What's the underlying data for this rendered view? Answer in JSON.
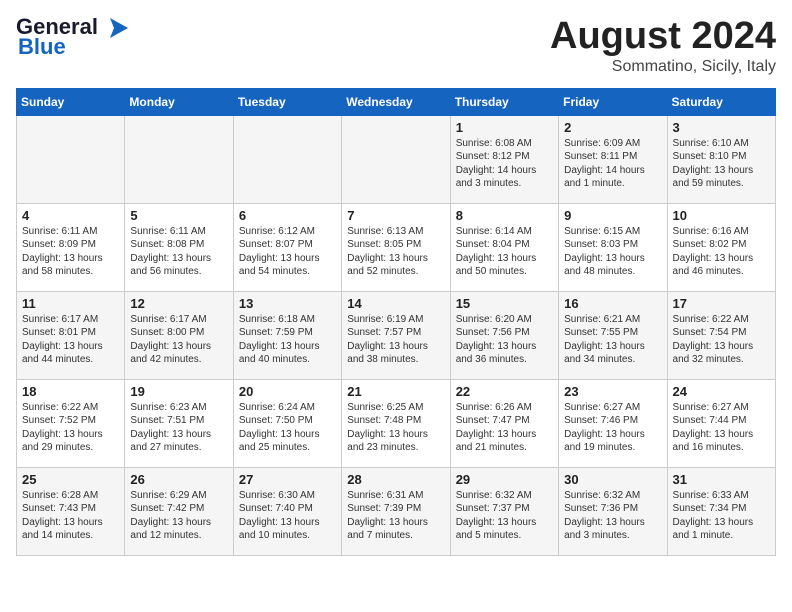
{
  "header": {
    "logo_line1": "General",
    "logo_line2": "Blue",
    "month": "August 2024",
    "location": "Sommatino, Sicily, Italy"
  },
  "weekdays": [
    "Sunday",
    "Monday",
    "Tuesday",
    "Wednesday",
    "Thursday",
    "Friday",
    "Saturday"
  ],
  "weeks": [
    [
      {
        "day": "",
        "info": ""
      },
      {
        "day": "",
        "info": ""
      },
      {
        "day": "",
        "info": ""
      },
      {
        "day": "",
        "info": ""
      },
      {
        "day": "1",
        "info": "Sunrise: 6:08 AM\nSunset: 8:12 PM\nDaylight: 14 hours\nand 3 minutes."
      },
      {
        "day": "2",
        "info": "Sunrise: 6:09 AM\nSunset: 8:11 PM\nDaylight: 14 hours\nand 1 minute."
      },
      {
        "day": "3",
        "info": "Sunrise: 6:10 AM\nSunset: 8:10 PM\nDaylight: 13 hours\nand 59 minutes."
      }
    ],
    [
      {
        "day": "4",
        "info": "Sunrise: 6:11 AM\nSunset: 8:09 PM\nDaylight: 13 hours\nand 58 minutes."
      },
      {
        "day": "5",
        "info": "Sunrise: 6:11 AM\nSunset: 8:08 PM\nDaylight: 13 hours\nand 56 minutes."
      },
      {
        "day": "6",
        "info": "Sunrise: 6:12 AM\nSunset: 8:07 PM\nDaylight: 13 hours\nand 54 minutes."
      },
      {
        "day": "7",
        "info": "Sunrise: 6:13 AM\nSunset: 8:05 PM\nDaylight: 13 hours\nand 52 minutes."
      },
      {
        "day": "8",
        "info": "Sunrise: 6:14 AM\nSunset: 8:04 PM\nDaylight: 13 hours\nand 50 minutes."
      },
      {
        "day": "9",
        "info": "Sunrise: 6:15 AM\nSunset: 8:03 PM\nDaylight: 13 hours\nand 48 minutes."
      },
      {
        "day": "10",
        "info": "Sunrise: 6:16 AM\nSunset: 8:02 PM\nDaylight: 13 hours\nand 46 minutes."
      }
    ],
    [
      {
        "day": "11",
        "info": "Sunrise: 6:17 AM\nSunset: 8:01 PM\nDaylight: 13 hours\nand 44 minutes."
      },
      {
        "day": "12",
        "info": "Sunrise: 6:17 AM\nSunset: 8:00 PM\nDaylight: 13 hours\nand 42 minutes."
      },
      {
        "day": "13",
        "info": "Sunrise: 6:18 AM\nSunset: 7:59 PM\nDaylight: 13 hours\nand 40 minutes."
      },
      {
        "day": "14",
        "info": "Sunrise: 6:19 AM\nSunset: 7:57 PM\nDaylight: 13 hours\nand 38 minutes."
      },
      {
        "day": "15",
        "info": "Sunrise: 6:20 AM\nSunset: 7:56 PM\nDaylight: 13 hours\nand 36 minutes."
      },
      {
        "day": "16",
        "info": "Sunrise: 6:21 AM\nSunset: 7:55 PM\nDaylight: 13 hours\nand 34 minutes."
      },
      {
        "day": "17",
        "info": "Sunrise: 6:22 AM\nSunset: 7:54 PM\nDaylight: 13 hours\nand 32 minutes."
      }
    ],
    [
      {
        "day": "18",
        "info": "Sunrise: 6:22 AM\nSunset: 7:52 PM\nDaylight: 13 hours\nand 29 minutes."
      },
      {
        "day": "19",
        "info": "Sunrise: 6:23 AM\nSunset: 7:51 PM\nDaylight: 13 hours\nand 27 minutes."
      },
      {
        "day": "20",
        "info": "Sunrise: 6:24 AM\nSunset: 7:50 PM\nDaylight: 13 hours\nand 25 minutes."
      },
      {
        "day": "21",
        "info": "Sunrise: 6:25 AM\nSunset: 7:48 PM\nDaylight: 13 hours\nand 23 minutes."
      },
      {
        "day": "22",
        "info": "Sunrise: 6:26 AM\nSunset: 7:47 PM\nDaylight: 13 hours\nand 21 minutes."
      },
      {
        "day": "23",
        "info": "Sunrise: 6:27 AM\nSunset: 7:46 PM\nDaylight: 13 hours\nand 19 minutes."
      },
      {
        "day": "24",
        "info": "Sunrise: 6:27 AM\nSunset: 7:44 PM\nDaylight: 13 hours\nand 16 minutes."
      }
    ],
    [
      {
        "day": "25",
        "info": "Sunrise: 6:28 AM\nSunset: 7:43 PM\nDaylight: 13 hours\nand 14 minutes."
      },
      {
        "day": "26",
        "info": "Sunrise: 6:29 AM\nSunset: 7:42 PM\nDaylight: 13 hours\nand 12 minutes."
      },
      {
        "day": "27",
        "info": "Sunrise: 6:30 AM\nSunset: 7:40 PM\nDaylight: 13 hours\nand 10 minutes."
      },
      {
        "day": "28",
        "info": "Sunrise: 6:31 AM\nSunset: 7:39 PM\nDaylight: 13 hours\nand 7 minutes."
      },
      {
        "day": "29",
        "info": "Sunrise: 6:32 AM\nSunset: 7:37 PM\nDaylight: 13 hours\nand 5 minutes."
      },
      {
        "day": "30",
        "info": "Sunrise: 6:32 AM\nSunset: 7:36 PM\nDaylight: 13 hours\nand 3 minutes."
      },
      {
        "day": "31",
        "info": "Sunrise: 6:33 AM\nSunset: 7:34 PM\nDaylight: 13 hours\nand 1 minute."
      }
    ]
  ]
}
